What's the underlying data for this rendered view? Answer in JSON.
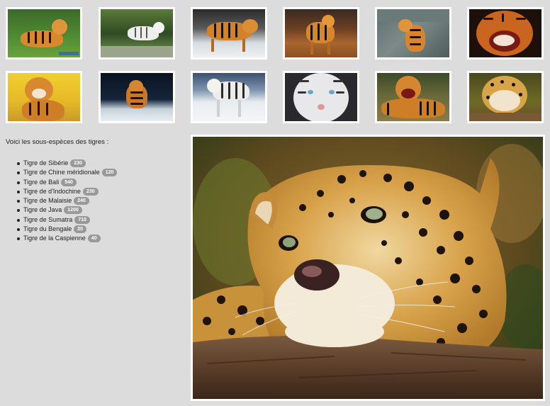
{
  "gallery": {
    "thumbnails": [
      {
        "alt": "tiger-lying-grass"
      },
      {
        "alt": "white-tiger-walking"
      },
      {
        "alt": "tiger-walking-snow"
      },
      {
        "alt": "tiger-standing-field"
      },
      {
        "alt": "tiger-by-rocks"
      },
      {
        "alt": "tiger-roaring-closeup"
      },
      {
        "alt": "tiger-cub-sitting"
      },
      {
        "alt": "tiger-in-snow-night"
      },
      {
        "alt": "white-tiger-snow"
      },
      {
        "alt": "white-tiger-face"
      },
      {
        "alt": "tiger-roaring-lying"
      },
      {
        "alt": "leopard-resting"
      }
    ]
  },
  "intro_text": "Voici les sous-espèces des tigres :",
  "species": [
    {
      "name": "Tigre de Sibérie",
      "count": "230"
    },
    {
      "name": "Tigre de Chine méridionale",
      "count": "120"
    },
    {
      "name": "Tigre de Bali",
      "count": "540"
    },
    {
      "name": "Tigre de d'Indochine",
      "count": "230"
    },
    {
      "name": "Tigre de Malaisie",
      "count": "240"
    },
    {
      "name": "Tigre de Java",
      "count": "1200"
    },
    {
      "name": "Tigre de Sumatra",
      "count": "710"
    },
    {
      "name": "Tigre du Bengale",
      "count": "20"
    },
    {
      "name": "Tigre de la Caspienne",
      "count": "40"
    }
  ],
  "main_image": {
    "alt": "leopard-resting-head-on-log"
  },
  "colors": {
    "background": "#dcdcdc",
    "frame": "#ffffff",
    "badge": "#999999"
  }
}
